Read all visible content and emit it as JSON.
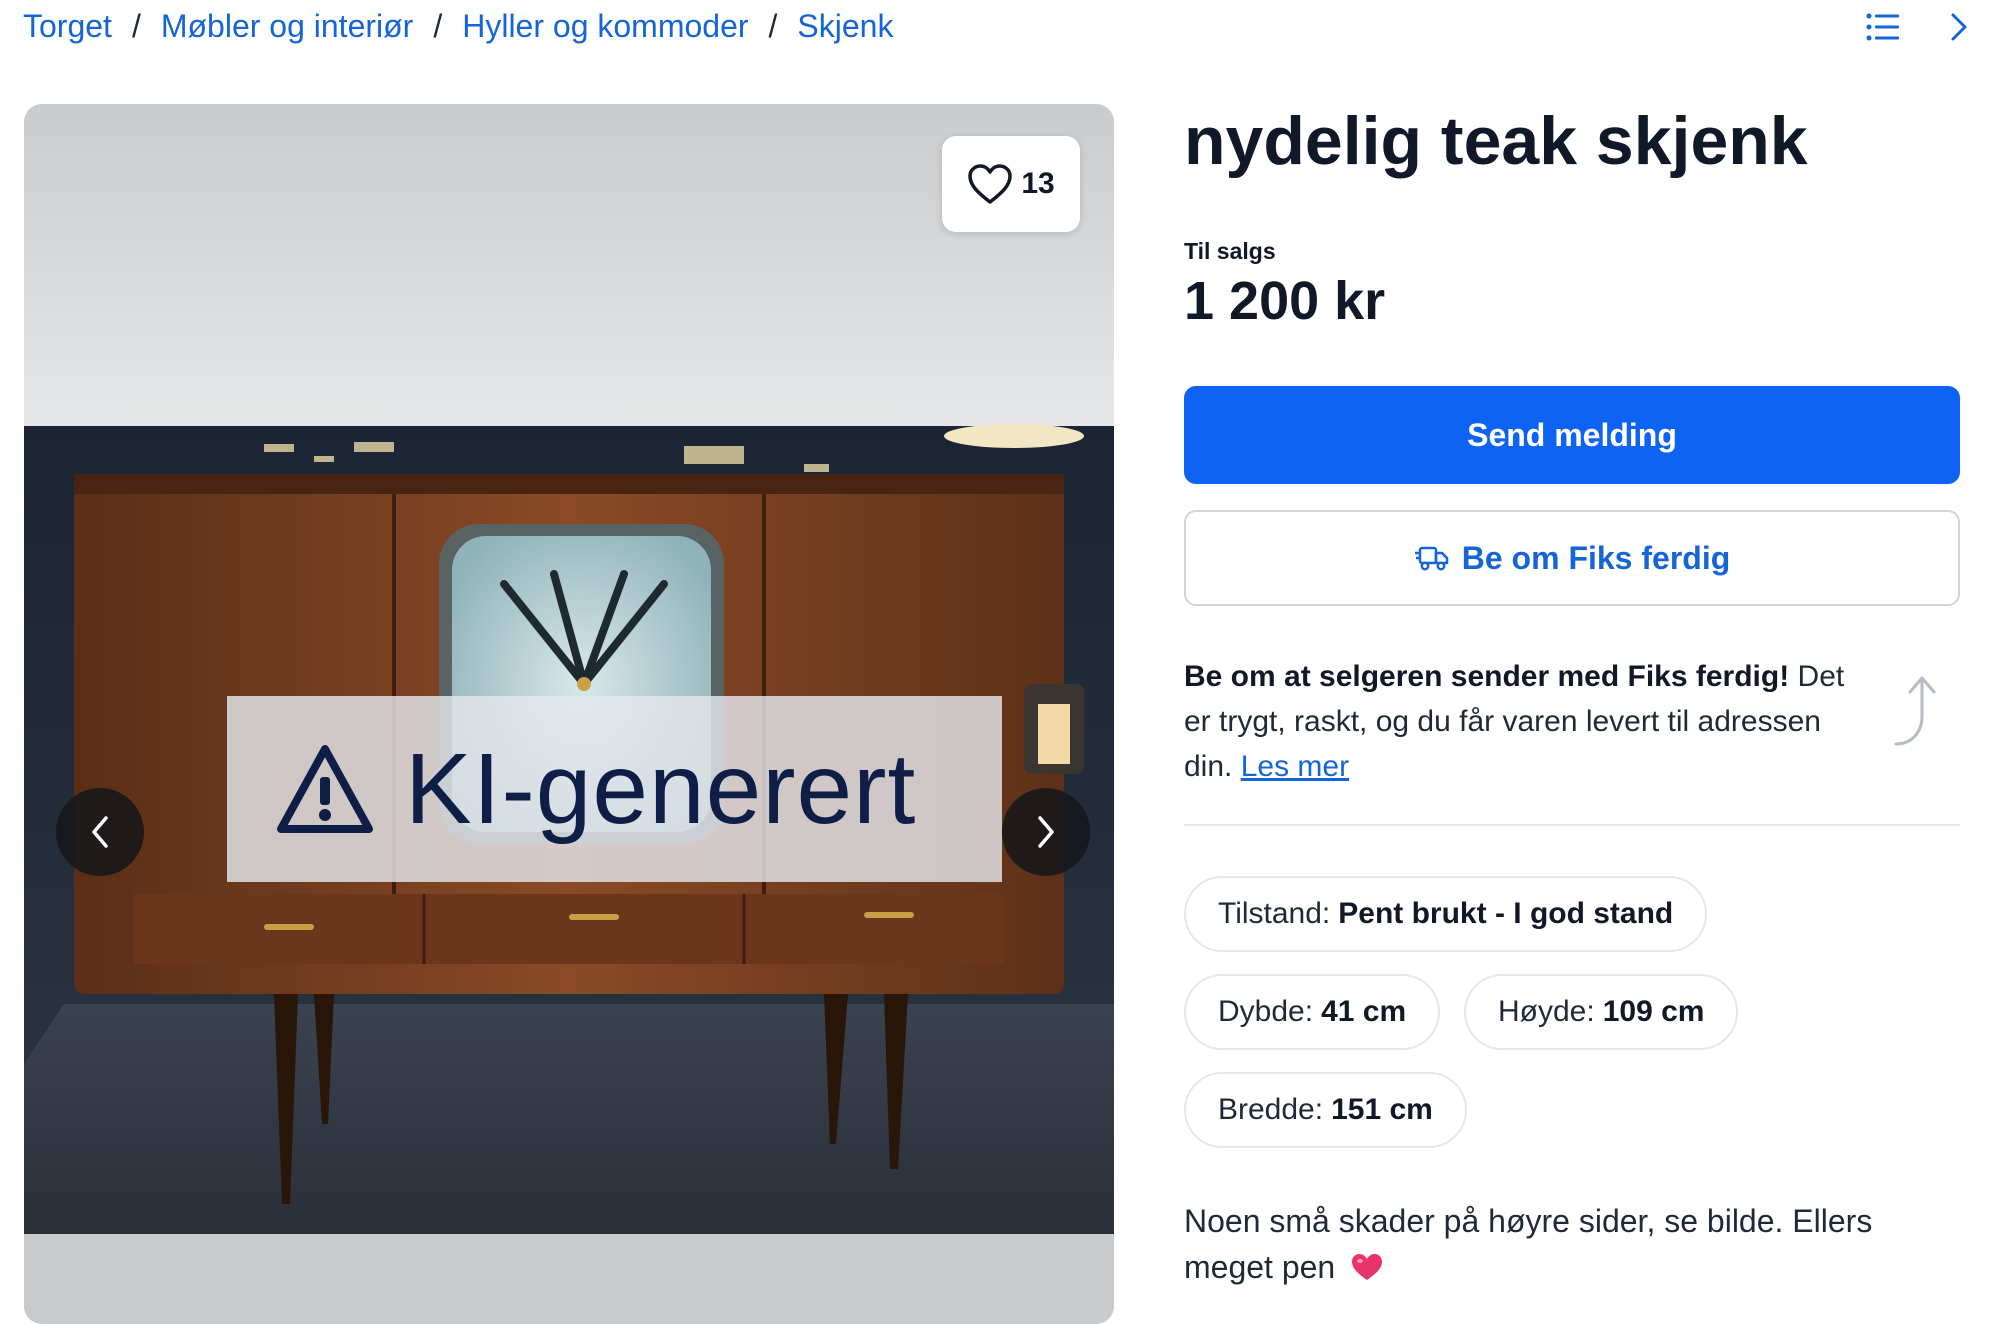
{
  "breadcrumb": {
    "items": [
      "Torget",
      "Møbler og interiør",
      "Hyller og kommoder",
      "Skjenk"
    ],
    "separator": "/"
  },
  "top_icons": {
    "list": "list-icon",
    "next": "chevron-right-icon"
  },
  "gallery": {
    "favorite_count": "13",
    "ai_label": "KI-generert",
    "icons": {
      "favorite": "heart-icon",
      "prev": "chevron-left-icon",
      "next": "chevron-right-icon",
      "warning": "warning-triangle-icon"
    }
  },
  "listing": {
    "title": "nydelig teak skjenk",
    "status": "Til salgs",
    "price": "1 200 kr"
  },
  "actions": {
    "send_message": "Send melding",
    "fiks_ferdig": "Be om Fiks ferdig",
    "fiks_icon": "delivery-truck-icon"
  },
  "promo": {
    "bold": "Be om at selgeren sender med Fiks ferdig!",
    "text": " Det er trygt, raskt, og du får varen levert til adressen din. ",
    "link": "Les mer",
    "icon": "arrow-up-icon"
  },
  "attributes": {
    "condition": {
      "label": "Tilstand:",
      "value": "Pent brukt - I god stand"
    },
    "depth": {
      "label": "Dybde:",
      "value": "41 cm"
    },
    "height": {
      "label": "Høyde:",
      "value": "109 cm"
    },
    "width": {
      "label": "Bredde:",
      "value": "151 cm"
    }
  },
  "description": {
    "text": "Noen små skader på høyre sider, se bilde. Ellers meget pen",
    "emoji_icon": "heart-emoji-icon"
  },
  "colors": {
    "link": "#1565d8",
    "primary_button": "#0e63f4",
    "heart_emoji": "#e8336b",
    "ai_text": "#0f1e47"
  }
}
